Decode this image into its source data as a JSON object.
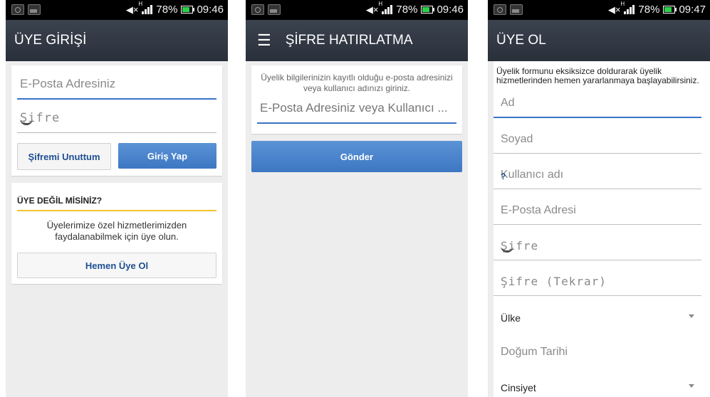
{
  "status": {
    "screens": [
      {
        "battery": "78%",
        "time": "09:46"
      },
      {
        "battery": "78%",
        "time": "09:46"
      },
      {
        "battery": "78%",
        "time": "09:47"
      }
    ]
  },
  "login": {
    "title": "ÜYE GİRİŞİ",
    "email_placeholder": "E-Posta Adresiniz",
    "password_placeholder": "Şifre",
    "forgot_button": "Şifremi Unuttum",
    "login_button": "Giriş Yap",
    "not_member_title": "ÜYE DEĞİL MİSİNİZ?",
    "not_member_text": "Üyelerimize özel hizmetlerimizden faydalanabilmek için üye olun.",
    "register_button": "Hemen Üye Ol"
  },
  "forgot": {
    "title": "ŞİFRE HATIRLATMA",
    "hint": "Üyelik bilgilerinizin kayıtlı olduğu e-posta adresinizi veya kullanıcı adınızı giriniz.",
    "input_placeholder": "E-Posta Adresiniz veya Kullanıcı ...",
    "submit_button": "Gönder"
  },
  "register": {
    "title": "ÜYE OL",
    "intro": "Üyelik formunu eksiksizce doldurarak üyelik hizmetlerinden hemen yararlanmaya başlayabilirsiniz.",
    "fields": {
      "first_name": "Ad",
      "last_name": "Soyad",
      "username": "Kullanıcı adı",
      "username_help": "?",
      "email": "E-Posta Adresi",
      "password": "Şifre",
      "password_repeat": "Şifre (Tekrar)",
      "country": "Ülke",
      "birth_date": "Doğum Tarihi",
      "gender": "Cinsiyet"
    }
  },
  "colors": {
    "appbar": "#2e3440",
    "accent_blue": "#3a74c8",
    "link_blue": "#1e4f93",
    "section_underline": "#f2c230"
  }
}
